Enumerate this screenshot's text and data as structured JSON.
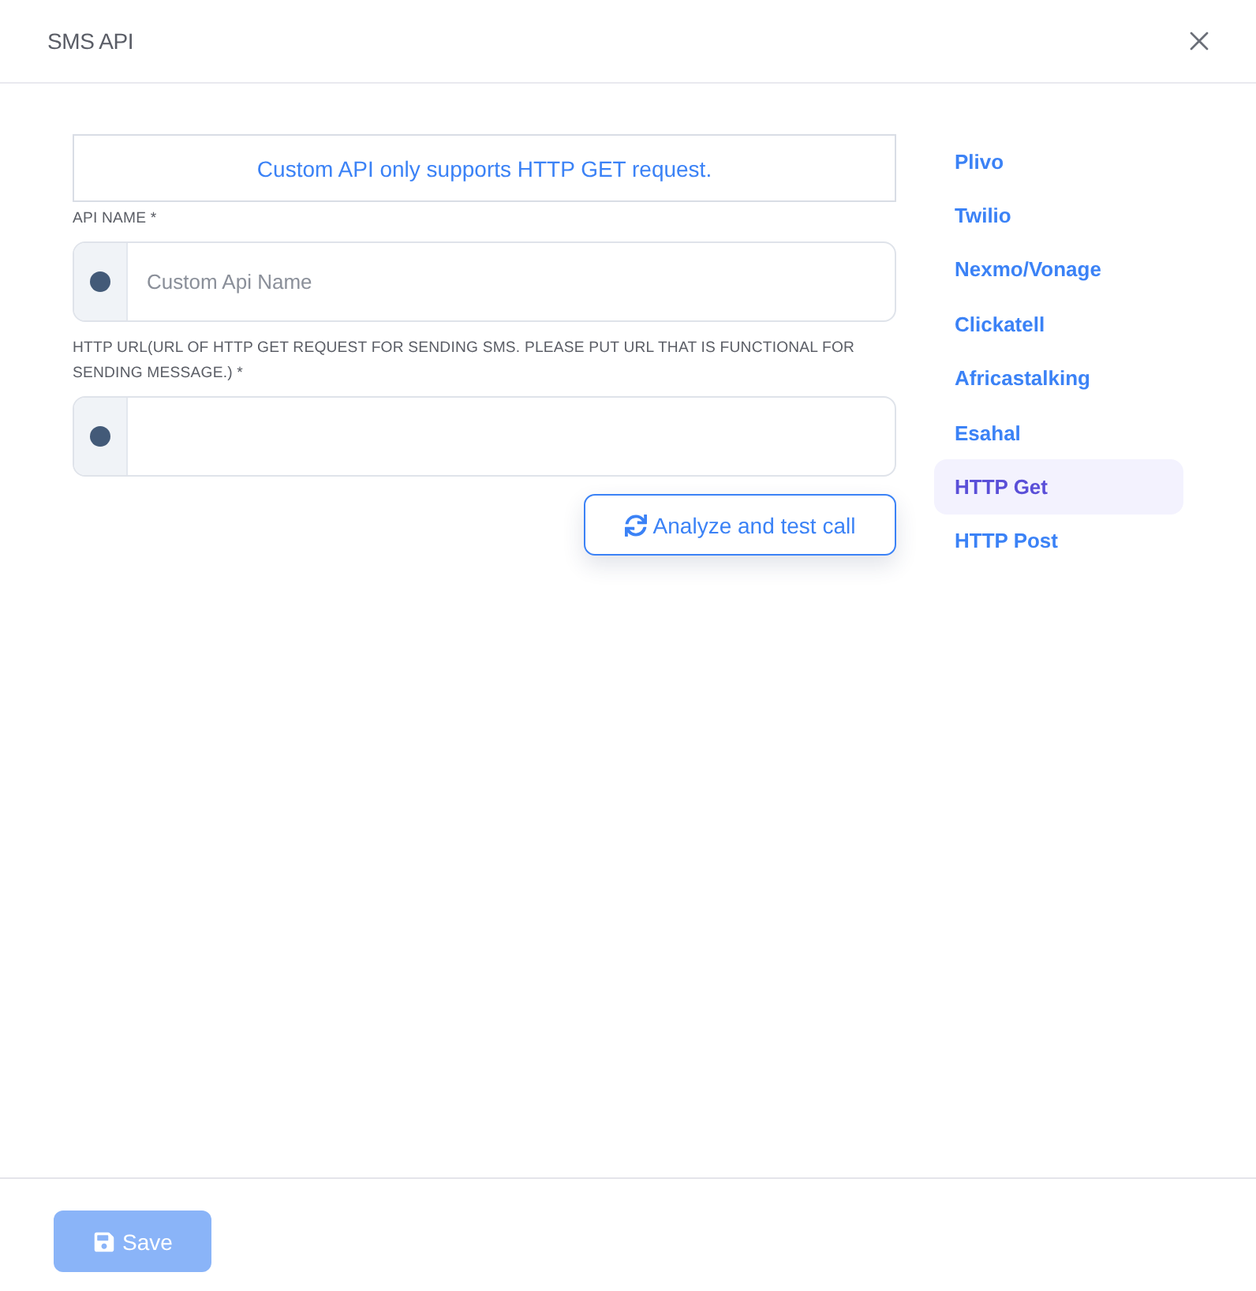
{
  "dialog": {
    "title": "SMS API"
  },
  "notice": "Custom API only supports HTTP GET request.",
  "fields": [
    {
      "label": "API NAME *",
      "placeholder": "Custom Api Name"
    },
    {
      "label": "HTTP URL(URL OF HTTP GET REQUEST FOR SENDING SMS. PLEASE PUT URL THAT IS FUNCTIONAL FOR SENDING MESSAGE.) *"
    }
  ],
  "test_button": {
    "label": "Analyze and test call"
  },
  "providers": [
    {
      "label": "Plivo",
      "selected": false
    },
    {
      "label": "Twilio",
      "selected": false
    },
    {
      "label": "Nexmo/Vonage",
      "selected": false
    },
    {
      "label": "Clickatell",
      "selected": false
    },
    {
      "label": "Africastalking",
      "selected": false
    },
    {
      "label": "Esahal",
      "selected": false
    },
    {
      "label": "HTTP Get",
      "selected": true
    },
    {
      "label": "HTTP Post",
      "selected": false
    }
  ],
  "footer": {
    "save_button": {
      "label": "Save",
      "disabled": true
    }
  }
}
